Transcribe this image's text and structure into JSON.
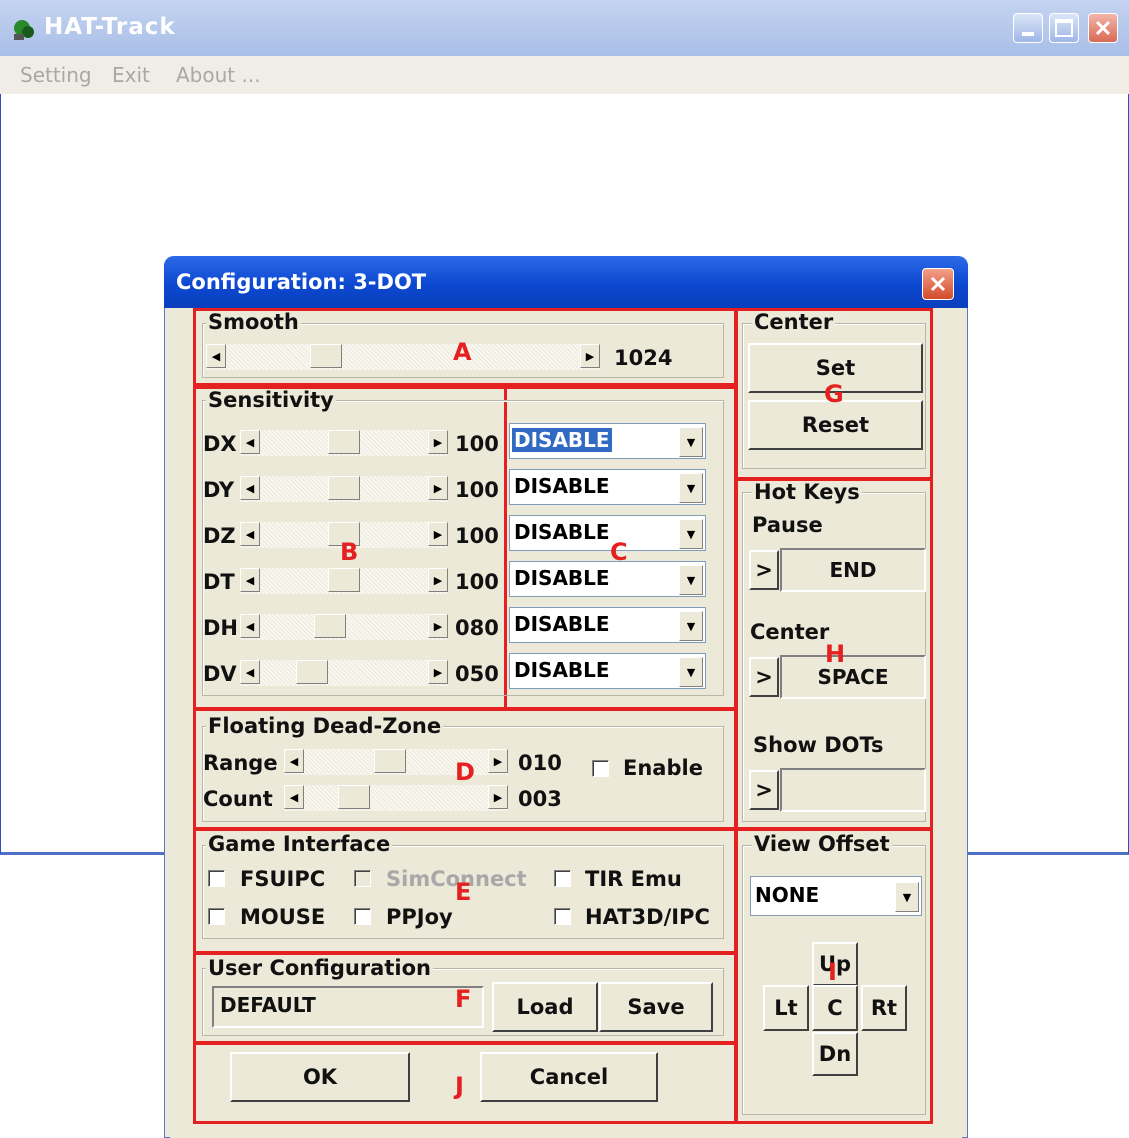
{
  "main_window": {
    "title": "HAT-Track",
    "menu": [
      "Setting",
      "Exit",
      "About ..."
    ]
  },
  "dialog": {
    "title": "Configuration: 3-DOT",
    "smooth": {
      "title": "Smooth",
      "value": "1024",
      "marker": "A"
    },
    "sensitivity": {
      "title": "Sensitivity",
      "marker_b": "B",
      "marker_c": "C",
      "rows": [
        {
          "label": "DX",
          "value": "100",
          "mode": "DISABLE"
        },
        {
          "label": "DY",
          "value": "100",
          "mode": "DISABLE"
        },
        {
          "label": "DZ",
          "value": "100",
          "mode": "DISABLE"
        },
        {
          "label": "DT",
          "value": "100",
          "mode": "DISABLE"
        },
        {
          "label": "DH",
          "value": "080",
          "mode": "DISABLE"
        },
        {
          "label": "DV",
          "value": "050",
          "mode": "DISABLE"
        }
      ]
    },
    "dead_zone": {
      "title": "Floating Dead-Zone",
      "range_label": "Range",
      "range_value": "010",
      "count_label": "Count",
      "count_value": "003",
      "enable_label": "Enable",
      "marker": "D"
    },
    "game_interface": {
      "title": "Game Interface",
      "options": [
        "FSUIPC",
        "SimConnect",
        "TIR Emu",
        "MOUSE",
        "PPJoy",
        "HAT3D/IPC"
      ],
      "marker": "E"
    },
    "user_config": {
      "title": "User Configuration",
      "value": "DEFAULT",
      "load_label": "Load",
      "save_label": "Save",
      "marker": "F"
    },
    "footer": {
      "ok_label": "OK",
      "cancel_label": "Cancel",
      "marker": "J"
    },
    "center": {
      "title": "Center",
      "set_label": "Set",
      "reset_label": "Reset",
      "marker": "G"
    },
    "hot_keys": {
      "title": "Hot Keys",
      "pause_label": "Pause",
      "pause_key": "END",
      "center_label": "Center",
      "center_key": "SPACE",
      "show_dots_label": "Show DOTs",
      "show_dots_key": "",
      "expand_glyph": ">",
      "marker": "H"
    },
    "view_offset": {
      "title": "View Offset",
      "mode": "NONE",
      "up_label": "Up",
      "left_label": "Lt",
      "center_label": "C",
      "right_label": "Rt",
      "down_label": "Dn",
      "marker": "I"
    }
  },
  "colors": {
    "annotation_red": "#e42020",
    "title_blue": "#0c48d0",
    "dialog_face": "#ece9d8",
    "selection": "#316ac5"
  }
}
